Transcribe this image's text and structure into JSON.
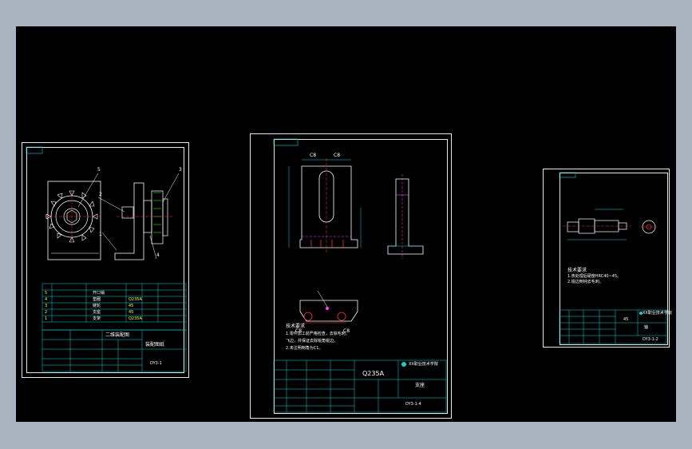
{
  "colors": {
    "background": "#aab4c0",
    "modelspace": "#000000",
    "sheet_border": "#e8e8e8",
    "title_lines": "#00d8d8",
    "text_green": "#00ff00",
    "text_yellow": "#ffff00",
    "dim_red": "#ff3030",
    "hidden_magenta": "#ff40ff"
  },
  "sheet1": {
    "balloons": [
      "5",
      "2",
      "3",
      "1",
      "4"
    ],
    "bom": [
      {
        "no": "5",
        "name": "开口销",
        "mat": ""
      },
      {
        "no": "4",
        "name": "垫圈",
        "mat": "Q235A"
      },
      {
        "no": "3",
        "name": "链轮",
        "mat": "45"
      },
      {
        "no": "2",
        "name": "支座",
        "mat": "45"
      },
      {
        "no": "1",
        "name": "支架",
        "mat": "Q235A"
      }
    ],
    "drawing_no": "DY3-1",
    "part_name": "二维装配图",
    "title_block_label": "装配图纸"
  },
  "sheet2": {
    "dim_labels": [
      "C8",
      "C8"
    ],
    "section_labels": [
      "C8",
      "C8"
    ],
    "notes_title": "技术要求",
    "notes": [
      "1.零件加工前严格检查，去除毛刺，",
      "飞边，并保证去除锐角锐边。",
      "2.未注明倒角为C1。"
    ],
    "material": "Q235A",
    "part_name": "支座",
    "drawing_no": "DY3-1-4",
    "school": "XX职业技术学院"
  },
  "sheet3": {
    "notes_title": "技术要求",
    "notes": [
      "1.热处理后硬度HRC40~45。",
      "2.锐边倒钝去毛刺。"
    ],
    "material": "45",
    "part_name": "轴",
    "drawing_no": "DY3-1-2",
    "school": "XX职业技术学院"
  }
}
